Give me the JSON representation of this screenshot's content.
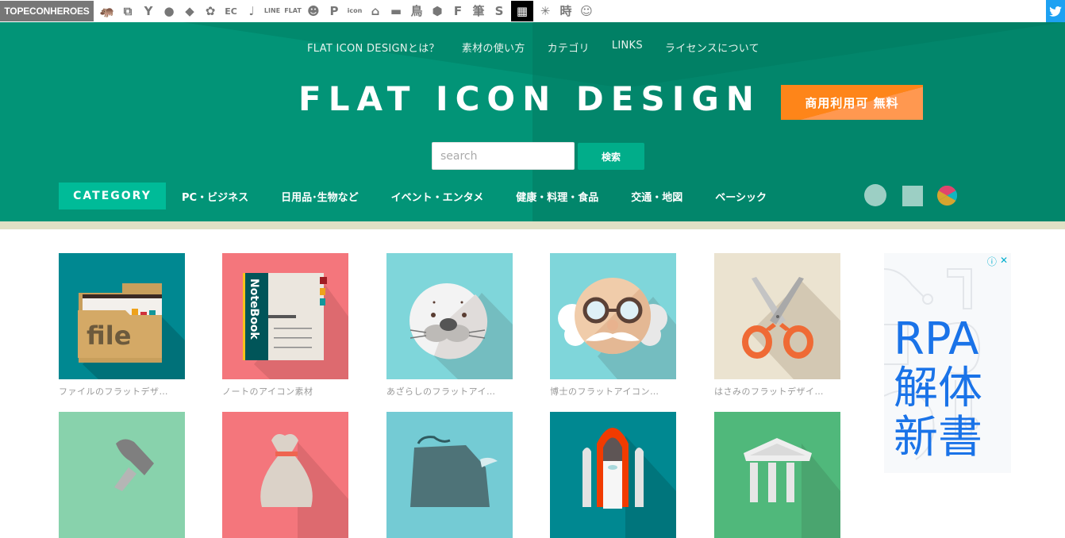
{
  "topbar": {
    "logo": "TOPECONHEROES",
    "icons": [
      {
        "name": "hippo-icon",
        "glyph": "🦛"
      },
      {
        "name": "copy-icon",
        "glyph": "⧉"
      },
      {
        "name": "person-cheer-icon",
        "glyph": "Y"
      },
      {
        "name": "speech-bubble-icon",
        "glyph": "●"
      },
      {
        "name": "arrow-shape-icon",
        "glyph": "◆"
      },
      {
        "name": "flower-icon",
        "glyph": "✿"
      },
      {
        "name": "ec-icon",
        "glyph": "EC"
      },
      {
        "name": "music-note-icon",
        "glyph": "♩"
      },
      {
        "name": "line-icon",
        "glyph": "LINE"
      },
      {
        "name": "flat-icon",
        "glyph": "FLAT"
      },
      {
        "name": "smiley-icon",
        "glyph": "☻"
      },
      {
        "name": "parking-icon",
        "glyph": "P"
      },
      {
        "name": "icon-text-icon",
        "glyph": "icon"
      },
      {
        "name": "building-icon",
        "glyph": "⌂"
      },
      {
        "name": "bench-icon",
        "glyph": "▬"
      },
      {
        "name": "bird-kanji-icon",
        "glyph": "鳥"
      },
      {
        "name": "pattern-circle-icon",
        "glyph": "⬢"
      },
      {
        "name": "f-logo-icon",
        "glyph": "F"
      },
      {
        "name": "brush-kanji-icon",
        "glyph": "筆"
      },
      {
        "name": "s-logo-icon",
        "glyph": "S"
      },
      {
        "name": "grid-icon",
        "glyph": "▦"
      },
      {
        "name": "burst-icon",
        "glyph": "✳"
      },
      {
        "name": "time-kanji-icon",
        "glyph": "時"
      },
      {
        "name": "face-icon",
        "glyph": "☺"
      }
    ],
    "twitter_icon": "twitter-icon"
  },
  "header": {
    "nav": [
      "FLAT ICON DESIGNとは？",
      "素材の使い方",
      "カテゴリ",
      "LINKS",
      "ライセンスについて"
    ],
    "title": "FLAT ICON DESIGN",
    "badge": "商用利用可 無料",
    "search": {
      "placeholder": "search",
      "value": "",
      "button": "検索"
    },
    "category_label": "CATEGORY",
    "categories": [
      "PC・ビジネス",
      "日用品･生物など",
      "イベント・エンタメ",
      "健康・料理・食品",
      "交通・地図",
      "ベーシック"
    ],
    "shape_filters": [
      "circle",
      "square",
      "color"
    ],
    "colors": {
      "header_left": "#029477",
      "header_right": "#02866b",
      "badge": "#fe8519",
      "category_label": "#00bb98",
      "search_button": "#01ad8a",
      "stripe": "#e0e0c5"
    }
  },
  "items": [
    {
      "caption": "ファイルのフラットデザ…",
      "subject": "file folder",
      "bg": "#008891"
    },
    {
      "caption": "ノートのアイコン素材",
      "subject": "notebook",
      "bg": "#f4767c"
    },
    {
      "caption": "あざらしのフラットアイ…",
      "subject": "seal",
      "bg": "#7fd6da"
    },
    {
      "caption": "博士のフラットアイコン…",
      "subject": "professor",
      "bg": "#7fd6da"
    },
    {
      "caption": "はさみのフラットデザイ…",
      "subject": "scissors",
      "bg": "#ebe3d0"
    },
    {
      "caption": "",
      "subject": "hammer",
      "bg": "#88d2ac"
    },
    {
      "caption": "",
      "subject": "money bag",
      "bg": "#f4767c"
    },
    {
      "caption": "",
      "subject": "rock",
      "bg": "#74cbd4"
    },
    {
      "caption": "",
      "subject": "space shuttle",
      "bg": "#008891"
    },
    {
      "caption": "",
      "subject": "bank building",
      "bg": "#50b87b"
    }
  ],
  "ad": {
    "text": "RPA\n解体\n新書",
    "info_icon": "ⓘ",
    "close_icon": "✕"
  }
}
